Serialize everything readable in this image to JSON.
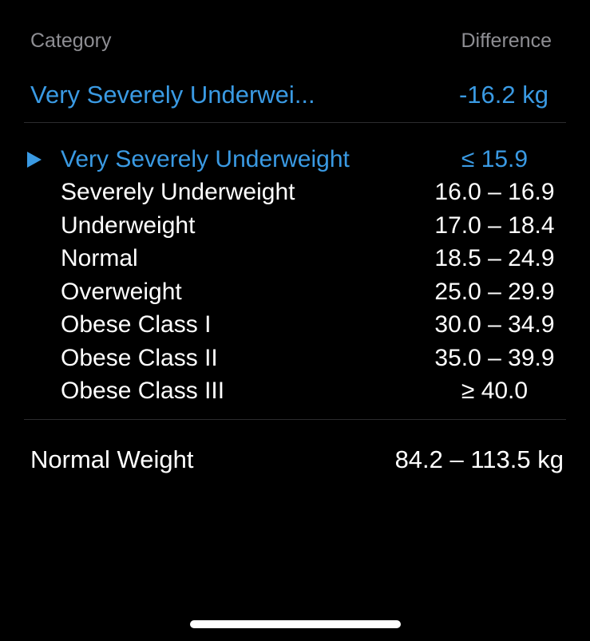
{
  "header": {
    "category_label": "Category",
    "difference_label": "Difference"
  },
  "current": {
    "category": "Very Severely Underwei...",
    "difference": "-16.2 kg"
  },
  "categories": [
    {
      "name": "Very Severely Underweight",
      "range": "≤ 15.9",
      "active": true
    },
    {
      "name": "Severely Underweight",
      "range": "16.0 – 16.9",
      "active": false
    },
    {
      "name": "Underweight",
      "range": "17.0 – 18.4",
      "active": false
    },
    {
      "name": "Normal",
      "range": "18.5 – 24.9",
      "active": false
    },
    {
      "name": "Overweight",
      "range": "25.0 – 29.9",
      "active": false
    },
    {
      "name": "Obese Class I",
      "range": "30.0 – 34.9",
      "active": false
    },
    {
      "name": "Obese Class II",
      "range": "35.0 – 39.9",
      "active": false
    },
    {
      "name": "Obese Class III",
      "range": "≥ 40.0",
      "active": false
    }
  ],
  "summary": {
    "label": "Normal Weight",
    "value": "84.2 – 113.5 kg"
  },
  "colors": {
    "accent": "#3a9ae3",
    "background": "#000000",
    "secondary_text": "#8e8e93",
    "divider": "#2c2c2e"
  },
  "icons": {
    "active_marker": "play-triangle-icon"
  }
}
